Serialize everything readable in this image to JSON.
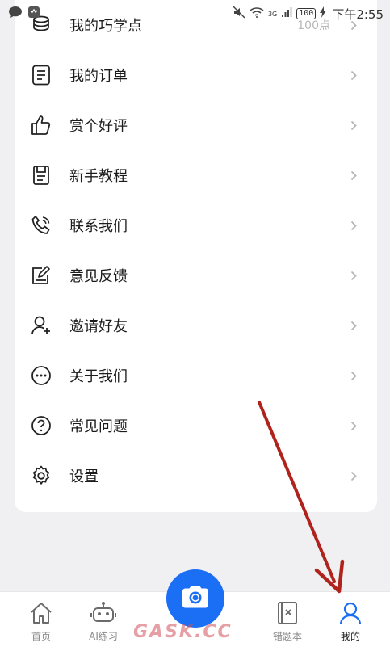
{
  "status_bar": {
    "time": "下午2:55",
    "battery": "100",
    "network": "3G"
  },
  "menu": {
    "items": [
      {
        "label": "我的巧学点",
        "value": "100点",
        "icon": "coins-icon"
      },
      {
        "label": "我的订单",
        "icon": "order-icon"
      },
      {
        "label": "赏个好评",
        "icon": "thumbs-up-icon"
      },
      {
        "label": "新手教程",
        "icon": "book-icon"
      },
      {
        "label": "联系我们",
        "icon": "phone-icon"
      },
      {
        "label": "意见反馈",
        "icon": "edit-icon"
      },
      {
        "label": "邀请好友",
        "icon": "add-user-icon"
      },
      {
        "label": "关于我们",
        "icon": "more-icon"
      },
      {
        "label": "常见问题",
        "icon": "help-icon"
      },
      {
        "label": "设置",
        "icon": "gear-icon"
      }
    ]
  },
  "bottom_nav": {
    "items": [
      {
        "label": "首页",
        "icon": "home-icon"
      },
      {
        "label": "AI练习",
        "icon": "robot-icon"
      },
      {
        "label": "",
        "icon": "camera-icon"
      },
      {
        "label": "错题本",
        "icon": "mistake-book-icon"
      },
      {
        "label": "我的",
        "icon": "user-icon",
        "active": true
      }
    ]
  },
  "watermark": "GASK.CC",
  "colors": {
    "accent": "#1b6ff5",
    "annotation_arrow": "#b0231c",
    "background": "#f0f0f2"
  }
}
